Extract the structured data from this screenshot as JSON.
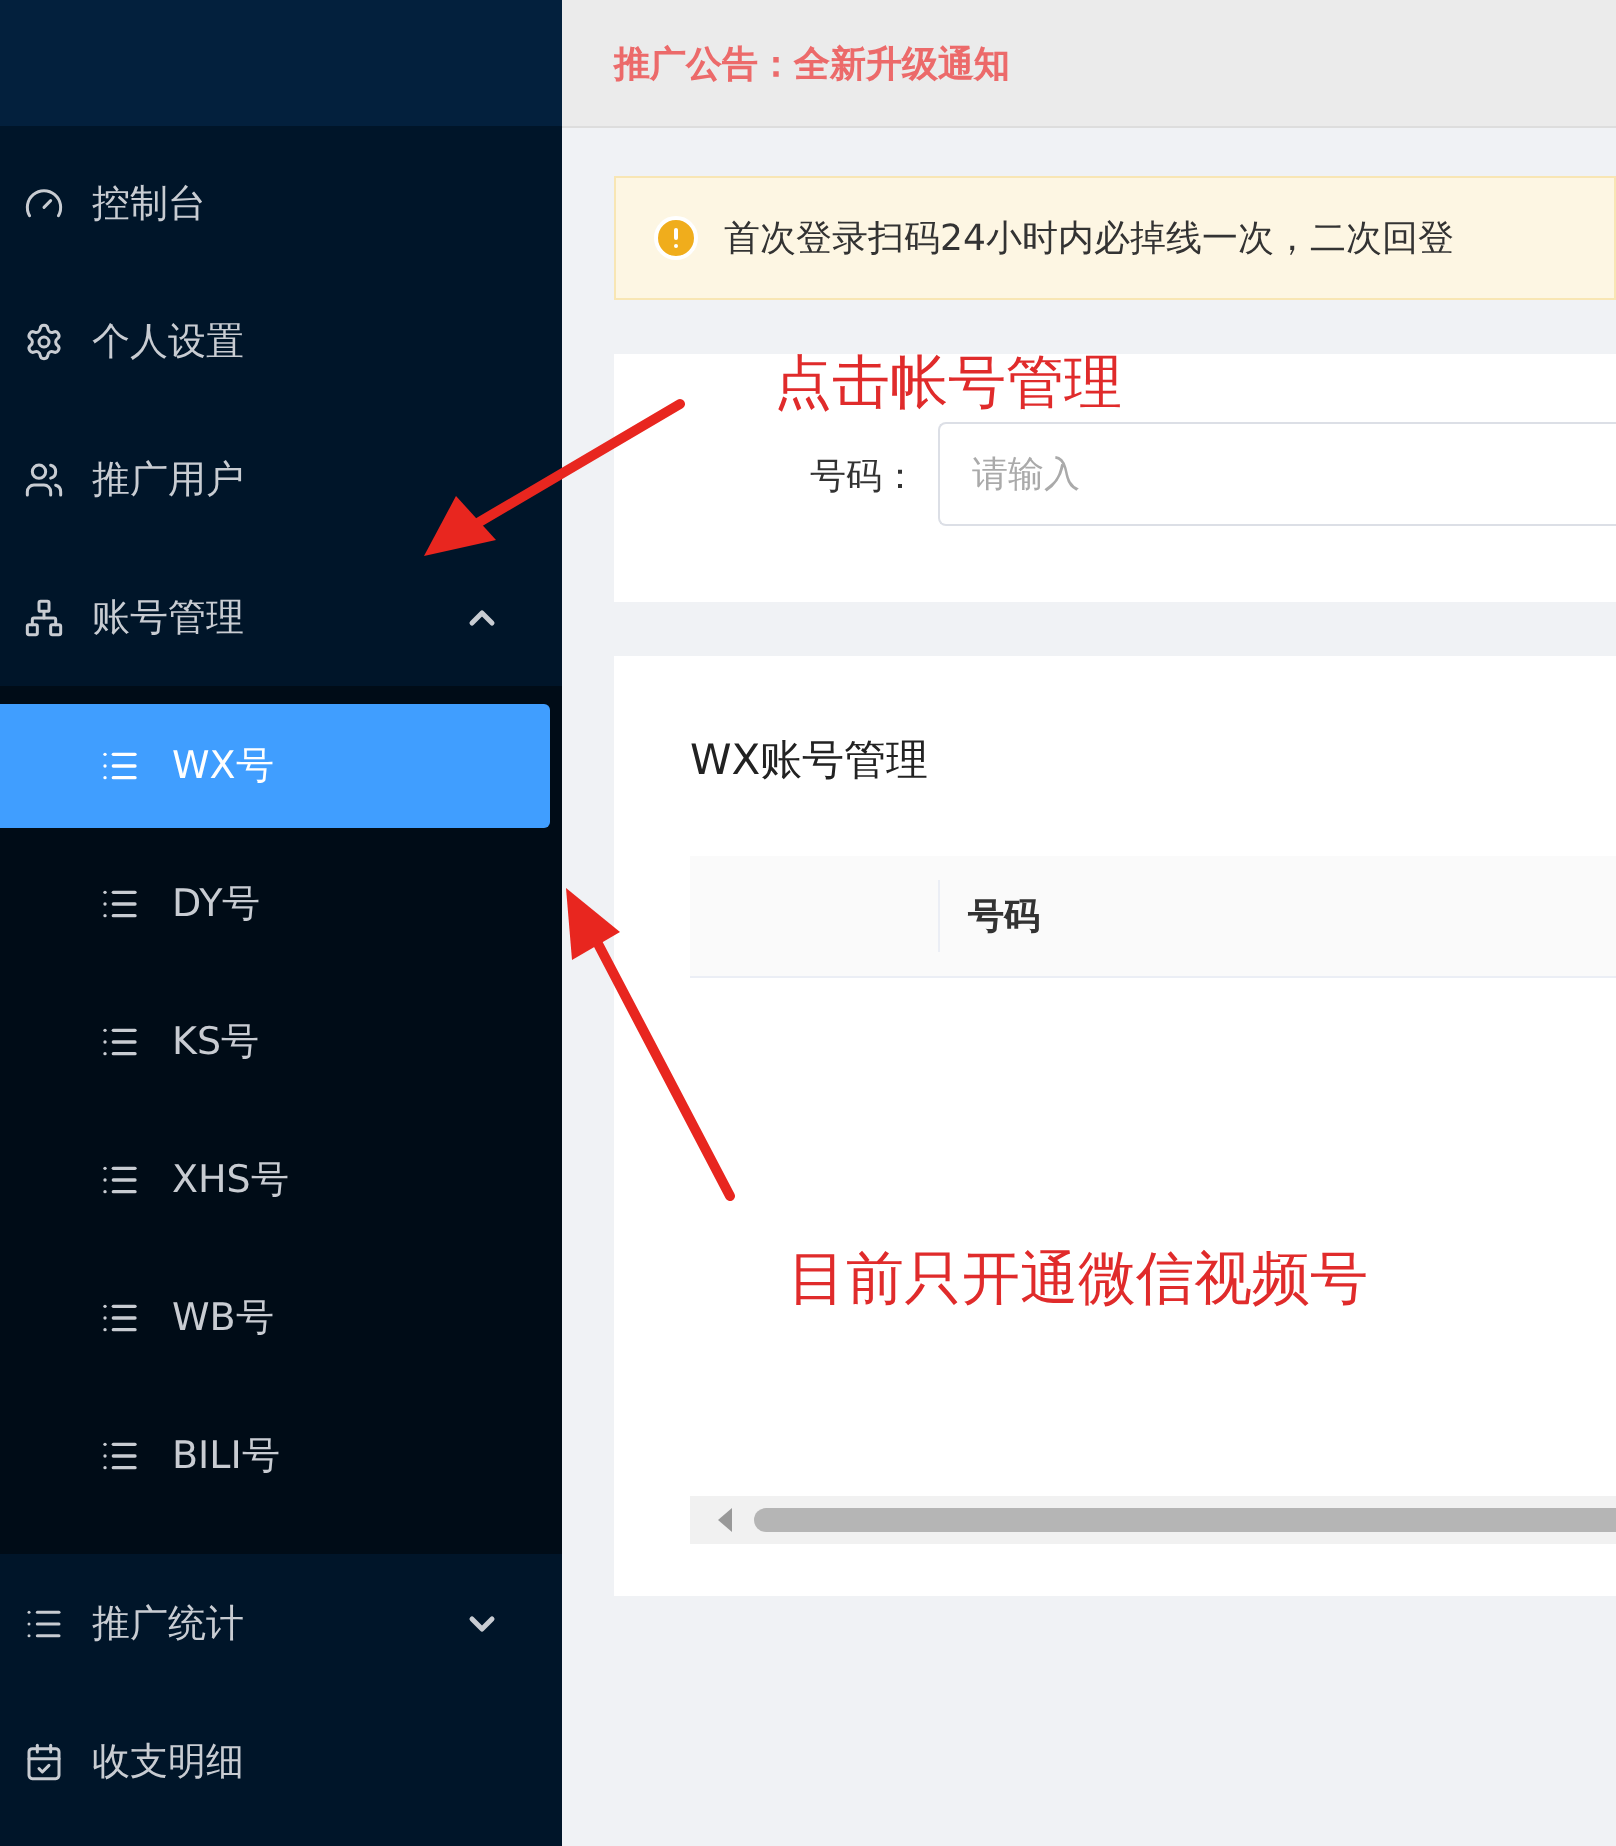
{
  "sidebar": {
    "items": [
      {
        "kind": "link",
        "label": "控制台",
        "selected": false
      },
      {
        "kind": "link",
        "label": "个人设置",
        "selected": false
      },
      {
        "kind": "link",
        "label": "推广用户",
        "selected": false
      },
      {
        "kind": "group",
        "label": "账号管理",
        "expanded": true,
        "children": [
          {
            "label": "WX号",
            "selected": true
          },
          {
            "label": "DY号",
            "selected": false
          },
          {
            "label": "KS号",
            "selected": false
          },
          {
            "label": "XHS号",
            "selected": false
          },
          {
            "label": "WB号",
            "selected": false
          },
          {
            "label": "BILI号",
            "selected": false
          }
        ]
      },
      {
        "kind": "group",
        "label": "推广统计",
        "expanded": false
      },
      {
        "kind": "link",
        "label": "收支明细",
        "selected": false
      }
    ]
  },
  "notice": "推广公告：全新升级通知",
  "alert": {
    "text": "首次登录扫码24小时内必掉线一次，二次回登"
  },
  "search": {
    "label": "号码：",
    "placeholder": "请输入"
  },
  "table": {
    "title": "WX账号管理",
    "columns": [
      "号码"
    ]
  },
  "annotations": [
    {
      "text": "点击帐号管理"
    },
    {
      "text": "目前只开通微信视频号"
    }
  ]
}
